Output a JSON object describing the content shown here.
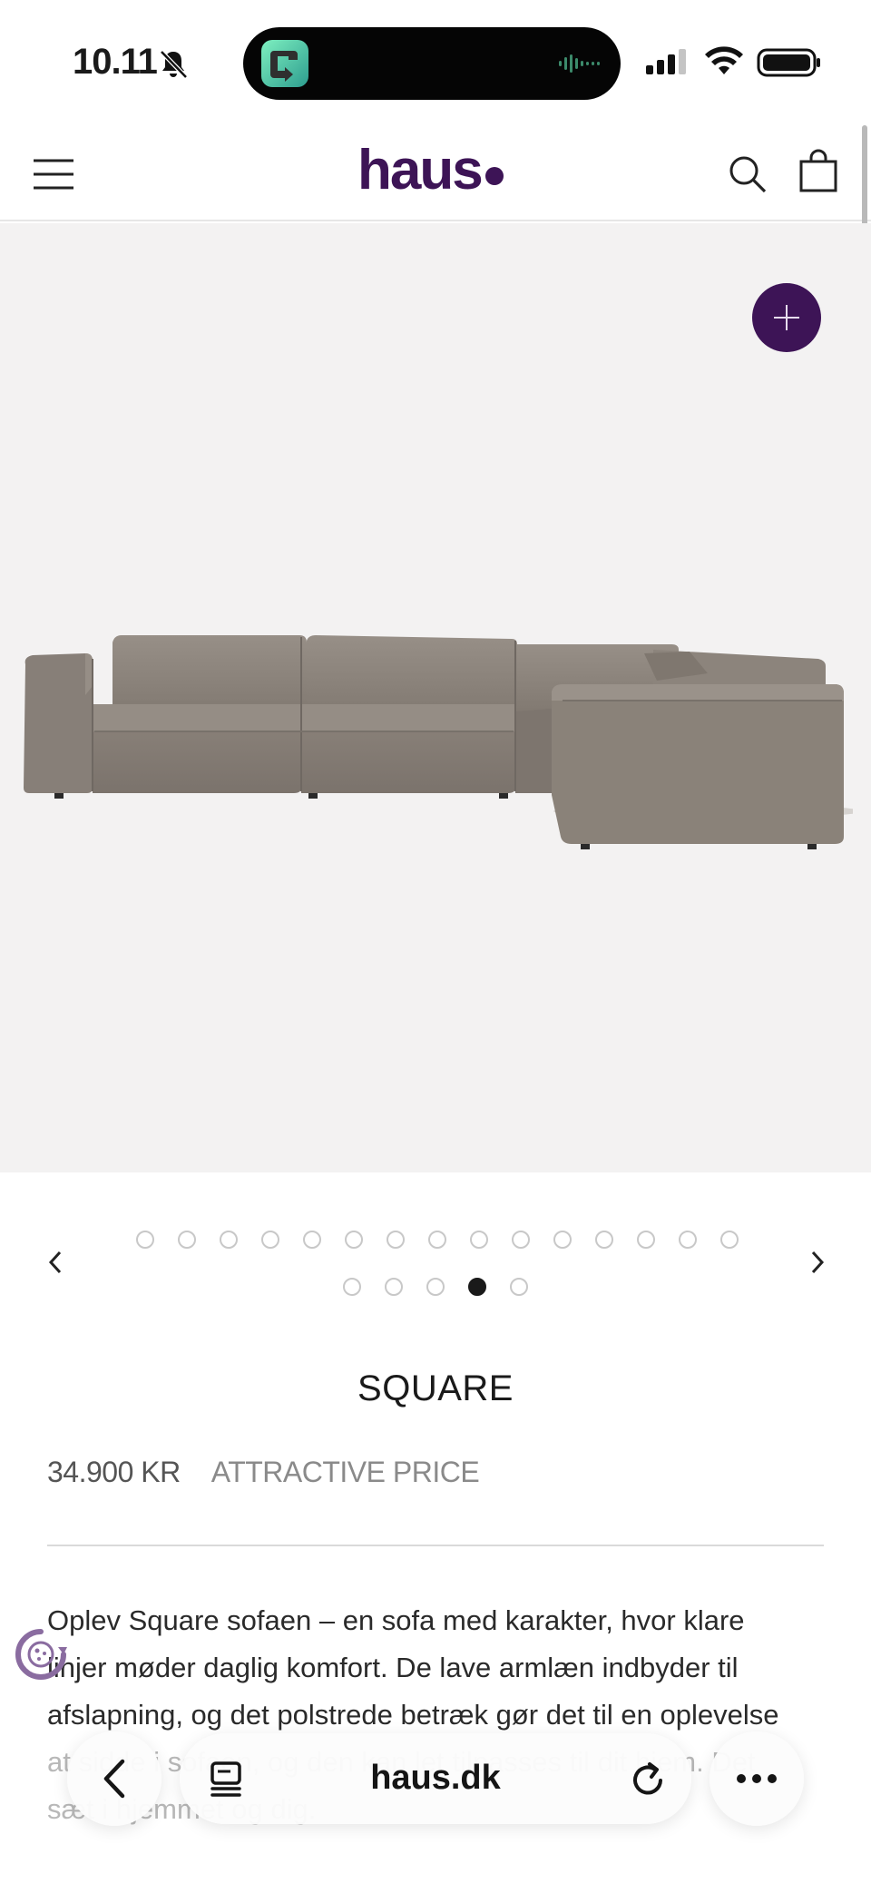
{
  "status_bar": {
    "time": "10.11",
    "icons": [
      "bell-muted-icon",
      "signal-icon",
      "wifi-icon",
      "battery-icon"
    ]
  },
  "header": {
    "logo": "haus",
    "icons": [
      "menu-icon",
      "search-icon",
      "bag-icon"
    ],
    "brand_color": "#3d1456"
  },
  "hero": {
    "image": "sofa-image",
    "action_icon": "plus-icon",
    "background": "#f3f2f2"
  },
  "carousel": {
    "total_images": 20,
    "active_index": 18,
    "prev_icon": "chevron-left-icon",
    "next_icon": "chevron-right-icon"
  },
  "product": {
    "title": "SQUARE",
    "price": "34.900 KR",
    "price_label": "ATTRACTIVE PRICE",
    "description_lines": [
      "Oplev Square sofaen – en sofa med karakter, hvor klare",
      "linjer møder daglig komfort. De lave armlæn indbyder til",
      "afslapning, og det polstrede betræk gør det til en oplevelse",
      "at sidde i sofaen, og den kan let tilpasses til dit hjem. Det",
      "sæt i hjemmet og dig."
    ]
  },
  "browser": {
    "url": "haus.dk",
    "icons": [
      "back-icon",
      "tabs-icon",
      "reload-icon",
      "more-icon"
    ]
  }
}
